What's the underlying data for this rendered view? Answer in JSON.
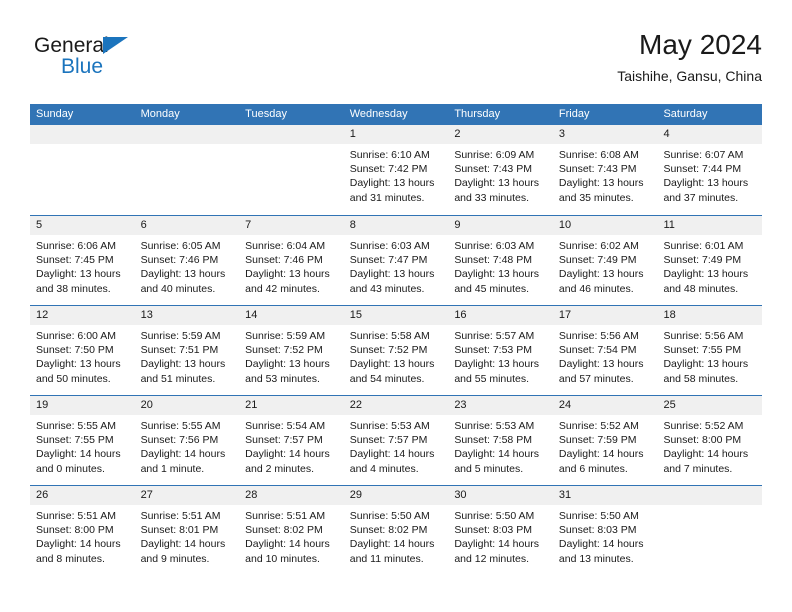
{
  "brand": {
    "name_part1": "General",
    "name_part2": "Blue",
    "triangle_icon": "triangle-icon",
    "accent_color": "#1b74bd"
  },
  "header": {
    "title": "May 2024",
    "subtitle": "Taishihe, Gansu, China",
    "header_bg_color": "#3174b5",
    "daynum_bg_color": "#f0f0f0"
  },
  "weekdays": [
    "Sunday",
    "Monday",
    "Tuesday",
    "Wednesday",
    "Thursday",
    "Friday",
    "Saturday"
  ],
  "labels": {
    "sunrise": "Sunrise:",
    "sunset": "Sunset:",
    "daylight": "Daylight:"
  },
  "weeks": [
    [
      {
        "day": "",
        "empty": true,
        "lines": []
      },
      {
        "day": "",
        "empty": true,
        "lines": []
      },
      {
        "day": "",
        "empty": true,
        "lines": []
      },
      {
        "day": "1",
        "empty": false,
        "lines": [
          "Sunrise: 6:10 AM",
          "Sunset: 7:42 PM",
          "Daylight: 13 hours",
          "and 31 minutes."
        ],
        "sunrise": "6:10 AM",
        "sunset": "7:42 PM",
        "daylight": "13 hours and 31 minutes."
      },
      {
        "day": "2",
        "empty": false,
        "lines": [
          "Sunrise: 6:09 AM",
          "Sunset: 7:43 PM",
          "Daylight: 13 hours",
          "and 33 minutes."
        ],
        "sunrise": "6:09 AM",
        "sunset": "7:43 PM",
        "daylight": "13 hours and 33 minutes."
      },
      {
        "day": "3",
        "empty": false,
        "lines": [
          "Sunrise: 6:08 AM",
          "Sunset: 7:43 PM",
          "Daylight: 13 hours",
          "and 35 minutes."
        ],
        "sunrise": "6:08 AM",
        "sunset": "7:43 PM",
        "daylight": "13 hours and 35 minutes."
      },
      {
        "day": "4",
        "empty": false,
        "lines": [
          "Sunrise: 6:07 AM",
          "Sunset: 7:44 PM",
          "Daylight: 13 hours",
          "and 37 minutes."
        ],
        "sunrise": "6:07 AM",
        "sunset": "7:44 PM",
        "daylight": "13 hours and 37 minutes."
      }
    ],
    [
      {
        "day": "5",
        "empty": false,
        "lines": [
          "Sunrise: 6:06 AM",
          "Sunset: 7:45 PM",
          "Daylight: 13 hours",
          "and 38 minutes."
        ],
        "sunrise": "6:06 AM",
        "sunset": "7:45 PM",
        "daylight": "13 hours and 38 minutes."
      },
      {
        "day": "6",
        "empty": false,
        "lines": [
          "Sunrise: 6:05 AM",
          "Sunset: 7:46 PM",
          "Daylight: 13 hours",
          "and 40 minutes."
        ],
        "sunrise": "6:05 AM",
        "sunset": "7:46 PM",
        "daylight": "13 hours and 40 minutes."
      },
      {
        "day": "7",
        "empty": false,
        "lines": [
          "Sunrise: 6:04 AM",
          "Sunset: 7:46 PM",
          "Daylight: 13 hours",
          "and 42 minutes."
        ],
        "sunrise": "6:04 AM",
        "sunset": "7:46 PM",
        "daylight": "13 hours and 42 minutes."
      },
      {
        "day": "8",
        "empty": false,
        "lines": [
          "Sunrise: 6:03 AM",
          "Sunset: 7:47 PM",
          "Daylight: 13 hours",
          "and 43 minutes."
        ],
        "sunrise": "6:03 AM",
        "sunset": "7:47 PM",
        "daylight": "13 hours and 43 minutes."
      },
      {
        "day": "9",
        "empty": false,
        "lines": [
          "Sunrise: 6:03 AM",
          "Sunset: 7:48 PM",
          "Daylight: 13 hours",
          "and 45 minutes."
        ],
        "sunrise": "6:03 AM",
        "sunset": "7:48 PM",
        "daylight": "13 hours and 45 minutes."
      },
      {
        "day": "10",
        "empty": false,
        "lines": [
          "Sunrise: 6:02 AM",
          "Sunset: 7:49 PM",
          "Daylight: 13 hours",
          "and 46 minutes."
        ],
        "sunrise": "6:02 AM",
        "sunset": "7:49 PM",
        "daylight": "13 hours and 46 minutes."
      },
      {
        "day": "11",
        "empty": false,
        "lines": [
          "Sunrise: 6:01 AM",
          "Sunset: 7:49 PM",
          "Daylight: 13 hours",
          "and 48 minutes."
        ],
        "sunrise": "6:01 AM",
        "sunset": "7:49 PM",
        "daylight": "13 hours and 48 minutes."
      }
    ],
    [
      {
        "day": "12",
        "empty": false,
        "lines": [
          "Sunrise: 6:00 AM",
          "Sunset: 7:50 PM",
          "Daylight: 13 hours",
          "and 50 minutes."
        ],
        "sunrise": "6:00 AM",
        "sunset": "7:50 PM",
        "daylight": "13 hours and 50 minutes."
      },
      {
        "day": "13",
        "empty": false,
        "lines": [
          "Sunrise: 5:59 AM",
          "Sunset: 7:51 PM",
          "Daylight: 13 hours",
          "and 51 minutes."
        ],
        "sunrise": "5:59 AM",
        "sunset": "7:51 PM",
        "daylight": "13 hours and 51 minutes."
      },
      {
        "day": "14",
        "empty": false,
        "lines": [
          "Sunrise: 5:59 AM",
          "Sunset: 7:52 PM",
          "Daylight: 13 hours",
          "and 53 minutes."
        ],
        "sunrise": "5:59 AM",
        "sunset": "7:52 PM",
        "daylight": "13 hours and 53 minutes."
      },
      {
        "day": "15",
        "empty": false,
        "lines": [
          "Sunrise: 5:58 AM",
          "Sunset: 7:52 PM",
          "Daylight: 13 hours",
          "and 54 minutes."
        ],
        "sunrise": "5:58 AM",
        "sunset": "7:52 PM",
        "daylight": "13 hours and 54 minutes."
      },
      {
        "day": "16",
        "empty": false,
        "lines": [
          "Sunrise: 5:57 AM",
          "Sunset: 7:53 PM",
          "Daylight: 13 hours",
          "and 55 minutes."
        ],
        "sunrise": "5:57 AM",
        "sunset": "7:53 PM",
        "daylight": "13 hours and 55 minutes."
      },
      {
        "day": "17",
        "empty": false,
        "lines": [
          "Sunrise: 5:56 AM",
          "Sunset: 7:54 PM",
          "Daylight: 13 hours",
          "and 57 minutes."
        ],
        "sunrise": "5:56 AM",
        "sunset": "7:54 PM",
        "daylight": "13 hours and 57 minutes."
      },
      {
        "day": "18",
        "empty": false,
        "lines": [
          "Sunrise: 5:56 AM",
          "Sunset: 7:55 PM",
          "Daylight: 13 hours",
          "and 58 minutes."
        ],
        "sunrise": "5:56 AM",
        "sunset": "7:55 PM",
        "daylight": "13 hours and 58 minutes."
      }
    ],
    [
      {
        "day": "19",
        "empty": false,
        "lines": [
          "Sunrise: 5:55 AM",
          "Sunset: 7:55 PM",
          "Daylight: 14 hours",
          "and 0 minutes."
        ],
        "sunrise": "5:55 AM",
        "sunset": "7:55 PM",
        "daylight": "14 hours and 0 minutes."
      },
      {
        "day": "20",
        "empty": false,
        "lines": [
          "Sunrise: 5:55 AM",
          "Sunset: 7:56 PM",
          "Daylight: 14 hours",
          "and 1 minute."
        ],
        "sunrise": "5:55 AM",
        "sunset": "7:56 PM",
        "daylight": "14 hours and 1 minute."
      },
      {
        "day": "21",
        "empty": false,
        "lines": [
          "Sunrise: 5:54 AM",
          "Sunset: 7:57 PM",
          "Daylight: 14 hours",
          "and 2 minutes."
        ],
        "sunrise": "5:54 AM",
        "sunset": "7:57 PM",
        "daylight": "14 hours and 2 minutes."
      },
      {
        "day": "22",
        "empty": false,
        "lines": [
          "Sunrise: 5:53 AM",
          "Sunset: 7:57 PM",
          "Daylight: 14 hours",
          "and 4 minutes."
        ],
        "sunrise": "5:53 AM",
        "sunset": "7:57 PM",
        "daylight": "14 hours and 4 minutes."
      },
      {
        "day": "23",
        "empty": false,
        "lines": [
          "Sunrise: 5:53 AM",
          "Sunset: 7:58 PM",
          "Daylight: 14 hours",
          "and 5 minutes."
        ],
        "sunrise": "5:53 AM",
        "sunset": "7:58 PM",
        "daylight": "14 hours and 5 minutes."
      },
      {
        "day": "24",
        "empty": false,
        "lines": [
          "Sunrise: 5:52 AM",
          "Sunset: 7:59 PM",
          "Daylight: 14 hours",
          "and 6 minutes."
        ],
        "sunrise": "5:52 AM",
        "sunset": "7:59 PM",
        "daylight": "14 hours and 6 minutes."
      },
      {
        "day": "25",
        "empty": false,
        "lines": [
          "Sunrise: 5:52 AM",
          "Sunset: 8:00 PM",
          "Daylight: 14 hours",
          "and 7 minutes."
        ],
        "sunrise": "5:52 AM",
        "sunset": "8:00 PM",
        "daylight": "14 hours and 7 minutes."
      }
    ],
    [
      {
        "day": "26",
        "empty": false,
        "lines": [
          "Sunrise: 5:51 AM",
          "Sunset: 8:00 PM",
          "Daylight: 14 hours",
          "and 8 minutes."
        ],
        "sunrise": "5:51 AM",
        "sunset": "8:00 PM",
        "daylight": "14 hours and 8 minutes."
      },
      {
        "day": "27",
        "empty": false,
        "lines": [
          "Sunrise: 5:51 AM",
          "Sunset: 8:01 PM",
          "Daylight: 14 hours",
          "and 9 minutes."
        ],
        "sunrise": "5:51 AM",
        "sunset": "8:01 PM",
        "daylight": "14 hours and 9 minutes."
      },
      {
        "day": "28",
        "empty": false,
        "lines": [
          "Sunrise: 5:51 AM",
          "Sunset: 8:02 PM",
          "Daylight: 14 hours",
          "and 10 minutes."
        ],
        "sunrise": "5:51 AM",
        "sunset": "8:02 PM",
        "daylight": "14 hours and 10 minutes."
      },
      {
        "day": "29",
        "empty": false,
        "lines": [
          "Sunrise: 5:50 AM",
          "Sunset: 8:02 PM",
          "Daylight: 14 hours",
          "and 11 minutes."
        ],
        "sunrise": "5:50 AM",
        "sunset": "8:02 PM",
        "daylight": "14 hours and 11 minutes."
      },
      {
        "day": "30",
        "empty": false,
        "lines": [
          "Sunrise: 5:50 AM",
          "Sunset: 8:03 PM",
          "Daylight: 14 hours",
          "and 12 minutes."
        ],
        "sunrise": "5:50 AM",
        "sunset": "8:03 PM",
        "daylight": "14 hours and 12 minutes."
      },
      {
        "day": "31",
        "empty": false,
        "lines": [
          "Sunrise: 5:50 AM",
          "Sunset: 8:03 PM",
          "Daylight: 14 hours",
          "and 13 minutes."
        ],
        "sunrise": "5:50 AM",
        "sunset": "8:03 PM",
        "daylight": "14 hours and 13 minutes."
      },
      {
        "day": "",
        "empty": true,
        "lines": []
      }
    ]
  ]
}
